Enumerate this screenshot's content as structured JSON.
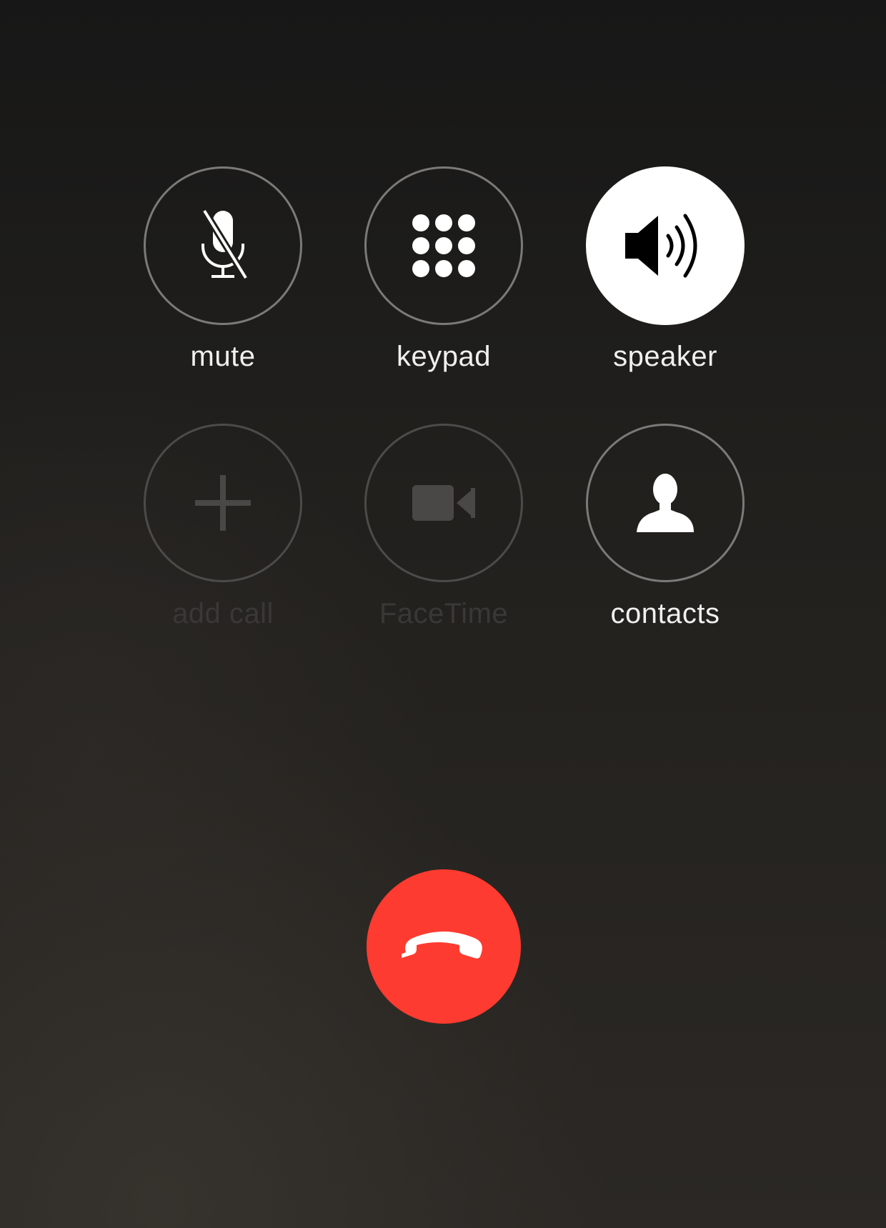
{
  "call_controls": {
    "mute": {
      "label": "mute",
      "icon": "mic-off-icon",
      "active": false,
      "enabled": true
    },
    "keypad": {
      "label": "keypad",
      "icon": "keypad-dots-icon",
      "active": false,
      "enabled": true
    },
    "speaker": {
      "label": "speaker",
      "icon": "speaker-icon",
      "active": true,
      "enabled": true
    },
    "add_call": {
      "label": "add call",
      "icon": "plus-icon",
      "active": false,
      "enabled": false
    },
    "facetime": {
      "label": "FaceTime",
      "icon": "video-camera-icon",
      "active": false,
      "enabled": false
    },
    "contacts": {
      "label": "contacts",
      "icon": "person-icon",
      "active": false,
      "enabled": true
    }
  },
  "end_call": {
    "icon": "phone-hangup-icon"
  },
  "colors": {
    "end_call_red": "#fe3b30",
    "ring_border": "#7b7a78",
    "active_fill": "#ffffff",
    "label_text": "#f0f0f0",
    "disabled_text": "#3a3836"
  }
}
